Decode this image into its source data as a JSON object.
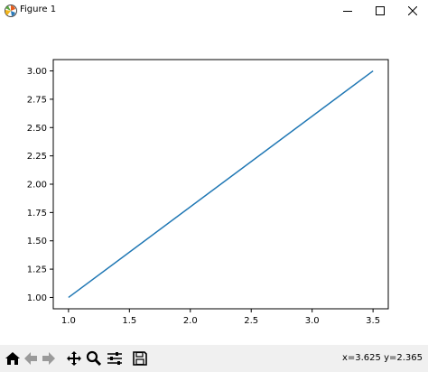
{
  "window": {
    "title": "Figure 1",
    "icon": "matplotlib-logo-icon",
    "controls": [
      "minimize-icon",
      "maximize-icon",
      "close-icon"
    ]
  },
  "chart_data": {
    "type": "line",
    "x": [
      1.0,
      3.5
    ],
    "series": [
      {
        "values": [
          1.0,
          3.0
        ],
        "color": "#1f77b4"
      }
    ],
    "xlim": [
      0.875,
      3.625
    ],
    "ylim": [
      0.9,
      3.1
    ],
    "xticks": [
      "1.0",
      "1.5",
      "2.0",
      "2.5",
      "3.0",
      "3.5"
    ],
    "yticks": [
      "1.00",
      "1.25",
      "1.50",
      "1.75",
      "2.00",
      "2.25",
      "2.50",
      "2.75",
      "3.00"
    ],
    "title": "",
    "xlabel": "",
    "ylabel": "",
    "grid": false
  },
  "toolbar": {
    "buttons": [
      "home-icon",
      "back-icon",
      "forward-icon",
      "pan-icon",
      "zoom-icon",
      "subplots-icon",
      "save-icon"
    ],
    "coords": "x=3.625 y=2.365"
  }
}
